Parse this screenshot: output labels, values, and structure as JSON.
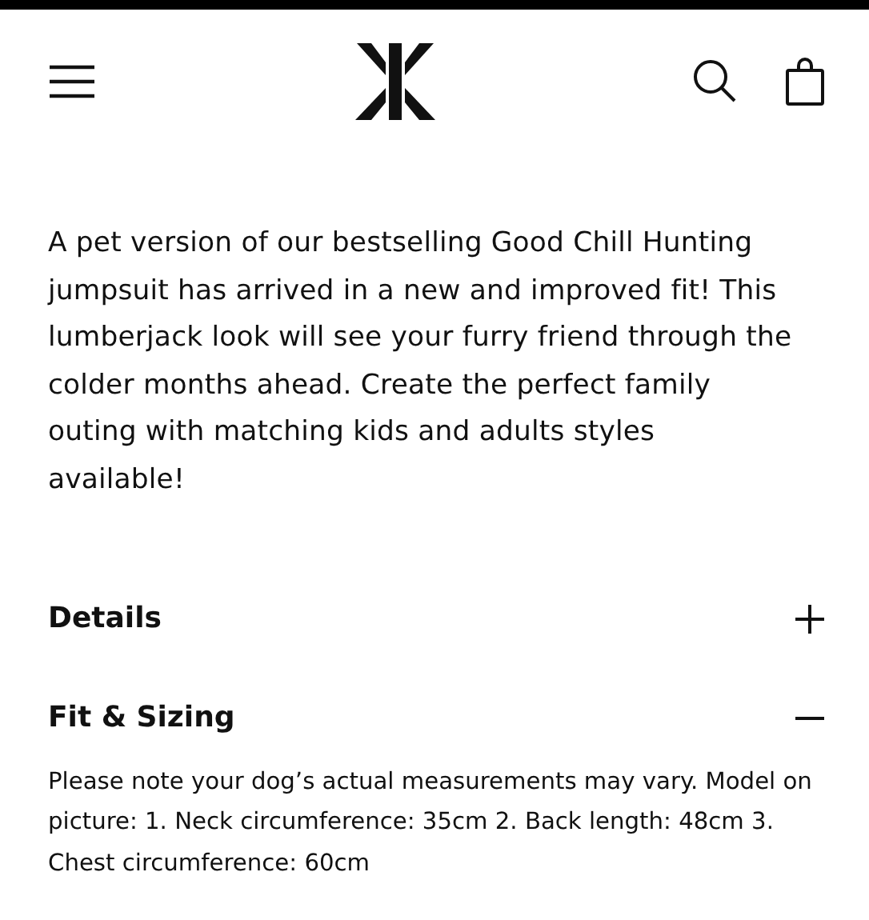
{
  "description": "A pet version of our bestselling Good Chill Hunting jumpsuit has arrived in a new and improved fit! This lumberjack look will see your furry friend through the colder months ahead. Create the perfect family outing with matching kids and adults styles available!",
  "sections": [
    {
      "title": "Details",
      "expanded": false
    },
    {
      "title": "Fit & Sizing",
      "expanded": true,
      "body": "Please note your dog’s actual measurements may vary. Model on picture: 1. Neck circumference: 35cm 2. Back length: 48cm 3. Chest circumference: 60cm"
    }
  ]
}
